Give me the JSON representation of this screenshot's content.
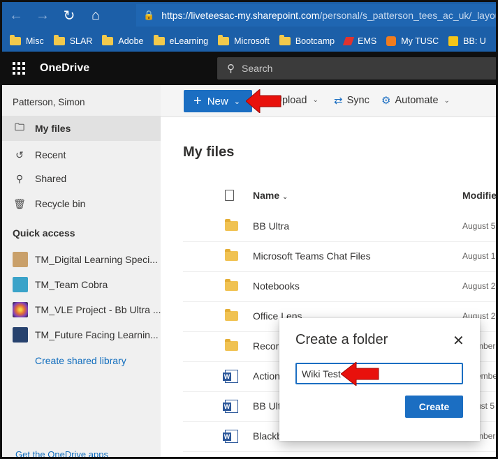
{
  "browser": {
    "url_host": "https://liveteesac-my.sharepoint.com",
    "url_path": "/personal/s_patterson_tees_ac_uk/_layou",
    "bookmarks": [
      "Misc",
      "SLAR",
      "Adobe",
      "eLearning",
      "Microsoft",
      "Bootcamp",
      "EMS",
      "My TUSC",
      "BB: U"
    ]
  },
  "app": {
    "brand": "OneDrive",
    "search_placeholder": "Search"
  },
  "nav": {
    "user": "Patterson, Simon",
    "items": [
      {
        "label": "My files",
        "icon": "folder-icon"
      },
      {
        "label": "Recent",
        "icon": "history-icon"
      },
      {
        "label": "Shared",
        "icon": "people-icon"
      },
      {
        "label": "Recycle bin",
        "icon": "recycle-bin-icon"
      }
    ],
    "quick_access_title": "Quick access",
    "libraries": [
      {
        "label": "TM_Digital Learning Speci...",
        "color": "#c9a06a"
      },
      {
        "label": "TM_Team Cobra",
        "color": "#e7a4c7"
      },
      {
        "label": "TM_VLE Project - Bb Ultra ...",
        "color": "#e06a3a"
      },
      {
        "label": "TM_Future Facing Learnin...",
        "color": "#27426e"
      }
    ],
    "create_library": "Create shared library",
    "get_apps": "Get the OneDrive apps"
  },
  "commands": {
    "new": "New",
    "upload": "Upload",
    "sync": "Sync",
    "automate": "Automate"
  },
  "content": {
    "title": "My files",
    "col_name": "Name",
    "col_modified": "Modifie",
    "rows": [
      {
        "type": "folder",
        "name": "BB Ultra",
        "modified": "August 5"
      },
      {
        "type": "folder",
        "name": "Microsoft Teams Chat Files",
        "modified": "August 1"
      },
      {
        "type": "folder",
        "name": "Notebooks",
        "modified": "August 2"
      },
      {
        "type": "folder",
        "name": "Office Lens",
        "modified": "August 2"
      },
      {
        "type": "folder",
        "name": "Recor",
        "modified": "mber"
      },
      {
        "type": "word",
        "name": "Action",
        "modified": "embe"
      },
      {
        "type": "word",
        "name": "BB Ult",
        "modified": "ust 5"
      },
      {
        "type": "word",
        "name": "Blackb",
        "modified": "mber"
      }
    ]
  },
  "dialog": {
    "title": "Create a folder",
    "input_value": "Wiki Test",
    "create_label": "Create"
  },
  "colors": {
    "accent": "#1b6ec2",
    "annotation_arrow": "#e8110c"
  }
}
